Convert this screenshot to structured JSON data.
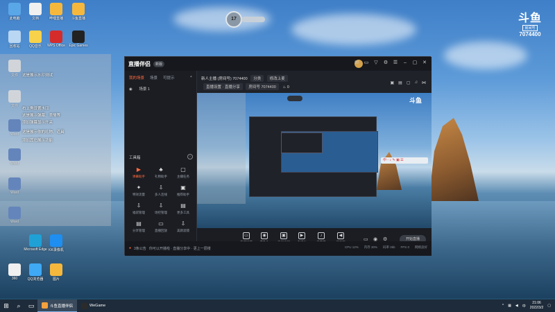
{
  "desktop": {
    "icons": [
      {
        "label": "此电脑",
        "color": "#5aa7e8"
      },
      {
        "label": "文档",
        "color": "#f0f0f0"
      },
      {
        "label": "哔哩直播",
        "color": "#f5b83d"
      },
      {
        "label": "斗鱼直播",
        "color": "#f5b83d"
      },
      {
        "label": "回收站",
        "color": "#b9d6f2"
      },
      {
        "label": "QQ音乐",
        "color": "#f7d24a"
      },
      {
        "label": "WPS Office",
        "color": "#d62b2b"
      },
      {
        "label": "Epic Games",
        "color": "#222222"
      },
      {
        "label": "文件",
        "color": "#f0f0f0"
      },
      {
        "label": "文件",
        "color": "#f0f0f0"
      },
      {
        "label": "Word",
        "color": "#2b5fb8"
      },
      {
        "label": "Word",
        "color": "#2b5fb8"
      },
      {
        "label": "Word",
        "color": "#2b5fb8"
      },
      {
        "label": "Word",
        "color": "#2b5fb8"
      },
      {
        "label": "Microsoft Edge",
        "color": "#1fa1d6"
      },
      {
        "label": "KK录像机",
        "color": "#1e8ef0"
      },
      {
        "label": "360",
        "color": "#f0f0f0"
      },
      {
        "label": "QQ浏览器",
        "color": "#3fa9f5"
      },
      {
        "label": "图片",
        "color": "#f5b83d"
      }
    ],
    "overlay_lines": [
      "这是展示水印测试",
      "右上角设置水印",
      "这是展示弹幕、表情等",
      "添加弹幕显示开关",
      "这是展示你的礼物、道具",
      "添加其它展示功能"
    ],
    "temperature": "17",
    "douyu_logo": {
      "mark": "斗鱼",
      "tag": "房间号",
      "room": "7074400"
    }
  },
  "app": {
    "name": "直播伴侣",
    "badge": "新版",
    "scene_tabs": [
      "我的场景",
      "场景",
      "可提示",
      "+"
    ],
    "scene_item": "场景 1",
    "tools_title": "工具箱",
    "tools": [
      {
        "label": "弹幕助手",
        "icon": "▶",
        "hot": true
      },
      {
        "label": "礼物助手",
        "icon": "♣",
        "hot": false
      },
      {
        "label": "主播任务",
        "icon": "▢",
        "hot": false
      },
      {
        "label": "特效流量",
        "icon": "✦",
        "hot": false
      },
      {
        "label": "多人连线",
        "icon": "⇩",
        "hot": false
      },
      {
        "label": "推荐助手",
        "icon": "▣",
        "hot": false
      },
      {
        "label": "福袋管理",
        "icon": "⇩",
        "hot": false
      },
      {
        "label": "场控管理",
        "icon": "⇩",
        "hot": false
      },
      {
        "label": "更多工具",
        "icon": "▤",
        "hot": false
      },
      {
        "label": "分享管理",
        "icon": "▤",
        "hot": false
      },
      {
        "label": "直播回放",
        "icon": "▭",
        "hot": false
      },
      {
        "label": "美颜滤镜",
        "icon": "⇩",
        "hot": false
      }
    ],
    "info": {
      "line1_prefix": "新人主播",
      "line1_room": "(房间号) 7074400",
      "line1_pill1": "分类",
      "line1_pill2": "修改上麦",
      "line2_pill1": "直播设置 · 直播分享",
      "line2_pill2": "房间号 7074400",
      "line2_count": "0"
    },
    "preview": {
      "toolbar_text": "中 ◦ ♪ ✎ ▣ ☰",
      "mini_logo": "斗鱼"
    },
    "controls": [
      {
        "label": "直播屏幕",
        "icon": "▭"
      },
      {
        "label": "摄像头",
        "icon": "◉"
      },
      {
        "label": "手机投屏",
        "icon": "▣"
      },
      {
        "label": "多媒体",
        "icon": "▶"
      },
      {
        "label": "麦克风",
        "icon": "♪"
      },
      {
        "label": "扬声器",
        "icon": "◀"
      }
    ],
    "start_live": "开始直播",
    "status": {
      "notice_prefix": "3条公告",
      "notice_text": "你可以开播啦 · 直播分享中 · 更上一层楼",
      "right": [
        "CPU 12%",
        "内存 30%",
        "码率 0kb",
        "FPS 0",
        "网络良好"
      ]
    }
  },
  "taskbar": {
    "tasks": [
      {
        "label": "斗鱼直播伴侣",
        "color": "#f5a13d",
        "active": true
      },
      {
        "label": "WeGame",
        "color": "#2b2b2b",
        "active": false
      }
    ],
    "time": "21:06",
    "date": "2022/3/2"
  }
}
